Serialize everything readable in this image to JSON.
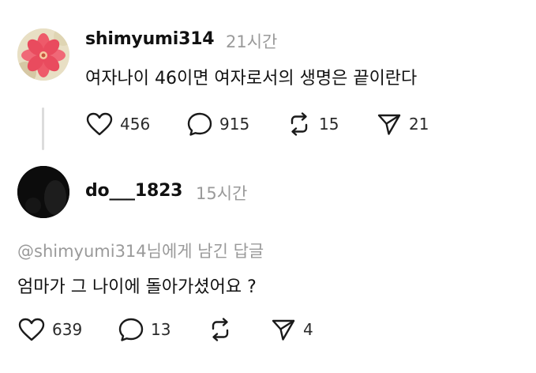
{
  "post1": {
    "username": "shimyumi314",
    "time": "21시간",
    "text": "여자나이 46이면 여자로서의 생명은 끝이란다",
    "actions": {
      "likes": "456",
      "comments": "915",
      "reposts": "15",
      "shares": "21"
    }
  },
  "post2": {
    "username": "do___1823",
    "time": "15시간",
    "reply_to": "@shimyumi314님에게 남긴 답글",
    "text": "엄마가 그 나이에 돌아가셨어요 ?",
    "actions": {
      "likes": "639",
      "comments": "13",
      "reposts": "",
      "shares": "4"
    }
  },
  "icons": {
    "like": "heart-icon",
    "comment": "comment-bubble-icon",
    "repost": "repost-icon",
    "share": "send-icon"
  }
}
